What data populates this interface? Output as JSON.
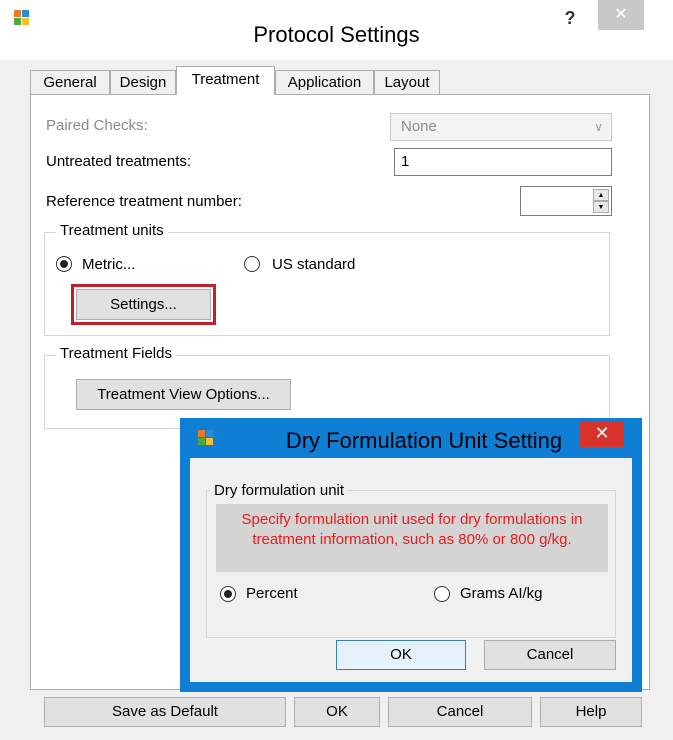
{
  "window": {
    "title": "Protocol Settings",
    "help_label": "?",
    "close_label": "✕",
    "tabs": [
      {
        "label": "General"
      },
      {
        "label": "Design"
      },
      {
        "label": "Treatment"
      },
      {
        "label": "Application"
      },
      {
        "label": "Layout"
      }
    ],
    "active_tab": "Treatment"
  },
  "treatment": {
    "paired_checks_label": "Paired Checks:",
    "paired_checks_value": "None",
    "untreated_label": "Untreated treatments:",
    "untreated_value": "1",
    "reference_label": "Reference treatment number:",
    "reference_value": "",
    "units_group_title": "Treatment units",
    "metric_label": "Metric...",
    "us_label": "US standard",
    "selected_unit": "Metric",
    "settings_button": "Settings...",
    "fields_group_title": "Treatment Fields",
    "view_options_button": "Treatment View Options..."
  },
  "footer": {
    "save_default": "Save as Default",
    "ok": "OK",
    "cancel": "Cancel",
    "help": "Help"
  },
  "dialog": {
    "title": "Dry Formulation Unit Setting",
    "close_label": "✕",
    "group_title": "Dry formulation unit",
    "message_line1": "Specify formulation unit used for dry formulations in",
    "message_line2": "treatment information, such as 80% or 800 g/kg.",
    "percent_label": "Percent",
    "grams_label": "Grams AI/kg",
    "selected": "Percent",
    "ok": "OK",
    "cancel": "Cancel"
  },
  "colors": {
    "highlight_border": "#c0202a",
    "dialog_frame": "#0f7fd6",
    "dialog_close": "#d8332a",
    "warning_text": "#e81c1c"
  },
  "icons": {
    "app_icon": "protocol-app-icon",
    "dialog_icon": "dialog-app-icon"
  }
}
